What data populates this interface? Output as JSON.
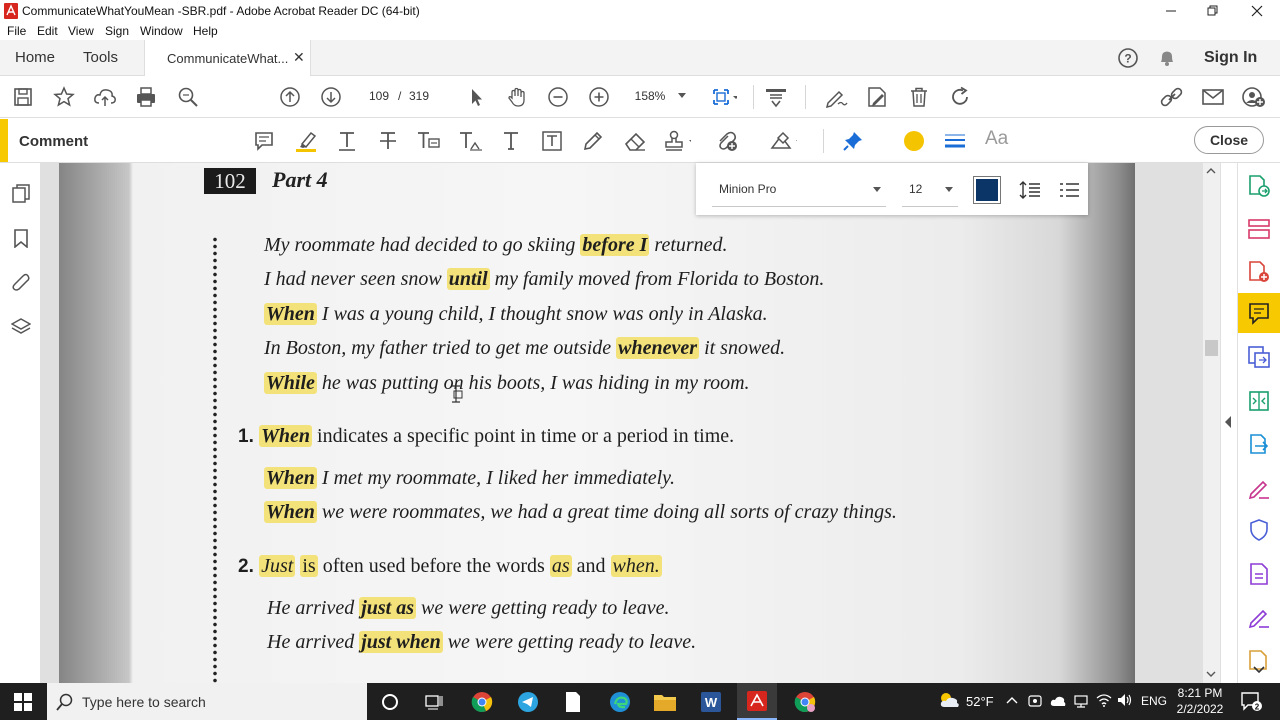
{
  "window": {
    "title": "CommunicateWhatYouMean -SBR.pdf - Adobe Acrobat Reader DC (64-bit)"
  },
  "menu": [
    "File",
    "Edit",
    "View",
    "Sign",
    "Window",
    "Help"
  ],
  "tabs": {
    "home": "Home",
    "tools": "Tools",
    "document": "CommunicateWhat...",
    "sign_in": "Sign In"
  },
  "toolbar": {
    "page_current": "109",
    "page_separator": "/",
    "page_total": "319",
    "zoom": "158%"
  },
  "comment_toolbar": {
    "label": "Comment",
    "close": "Close",
    "highlight_color": "#f5c400",
    "text_icon_label": "Aa"
  },
  "font_popup": {
    "font_name": "Minion Pro",
    "font_size": "12",
    "font_color": "#0b3566"
  },
  "document": {
    "page_number": "102",
    "part_title": "Part 4",
    "lines": [
      {
        "kind": "example",
        "parts": [
          {
            "t": "My roommate had decided to go skiing "
          },
          {
            "t": "before I",
            "hl": true,
            "b": true
          },
          {
            "t": " returned."
          }
        ]
      },
      {
        "kind": "example",
        "parts": [
          {
            "t": "I had never seen snow "
          },
          {
            "t": "until",
            "hl": true,
            "b": true
          },
          {
            "t": " my family moved from Florida to Boston."
          }
        ]
      },
      {
        "kind": "example",
        "parts": [
          {
            "t": "When",
            "hl": true,
            "b": true
          },
          {
            "t": " I was a young child, I thought snow was only in Alaska."
          }
        ]
      },
      {
        "kind": "example",
        "parts": [
          {
            "t": "In Boston, my father tried to get me outside "
          },
          {
            "t": "whenever",
            "hl": true,
            "b": true
          },
          {
            "t": " it snowed."
          }
        ]
      },
      {
        "kind": "example",
        "parts": [
          {
            "t": "While",
            "hl": true,
            "b": true
          },
          {
            "t": " he was putting on his boots, I was hiding in my room."
          }
        ]
      },
      {
        "kind": "rule",
        "number": "1.",
        "parts": [
          {
            "t": "When",
            "hl": true,
            "b": true,
            "i": true
          },
          {
            "t": " indicates a specific point in time or a period in time."
          }
        ]
      },
      {
        "kind": "example",
        "parts": [
          {
            "t": "When",
            "hl": true,
            "b": true
          },
          {
            "t": " I met my roommate, I liked her immediately."
          }
        ]
      },
      {
        "kind": "example",
        "parts": [
          {
            "t": "When",
            "hl": true,
            "b": true
          },
          {
            "t": " we were roommates, we had a great time doing all sorts of crazy things."
          }
        ]
      },
      {
        "kind": "rule",
        "number": "2.",
        "parts": [
          {
            "t": "Just",
            "hl": true,
            "i": true
          },
          {
            "t": " "
          },
          {
            "t": "is",
            "hl": true
          },
          {
            "t": " often used before the words "
          },
          {
            "t": "as",
            "hl": true,
            "i": true
          },
          {
            "t": " and "
          },
          {
            "t": "when.",
            "hl": true,
            "i": true
          }
        ]
      },
      {
        "kind": "example",
        "parts": [
          {
            "t": "He arrived "
          },
          {
            "t": "just as",
            "hl": true,
            "b": true
          },
          {
            "t": " we were getting ready to leave."
          }
        ]
      },
      {
        "kind": "example",
        "parts": [
          {
            "t": "He arrived "
          },
          {
            "t": "just when",
            "hl": true,
            "b": true
          },
          {
            "t": " we were getting ready to leave."
          }
        ]
      }
    ]
  },
  "taskbar": {
    "search_placeholder": "Type here to search",
    "weather": "52°F",
    "language": "ENG",
    "time": "8:21 PM",
    "date": "2/2/2022"
  }
}
